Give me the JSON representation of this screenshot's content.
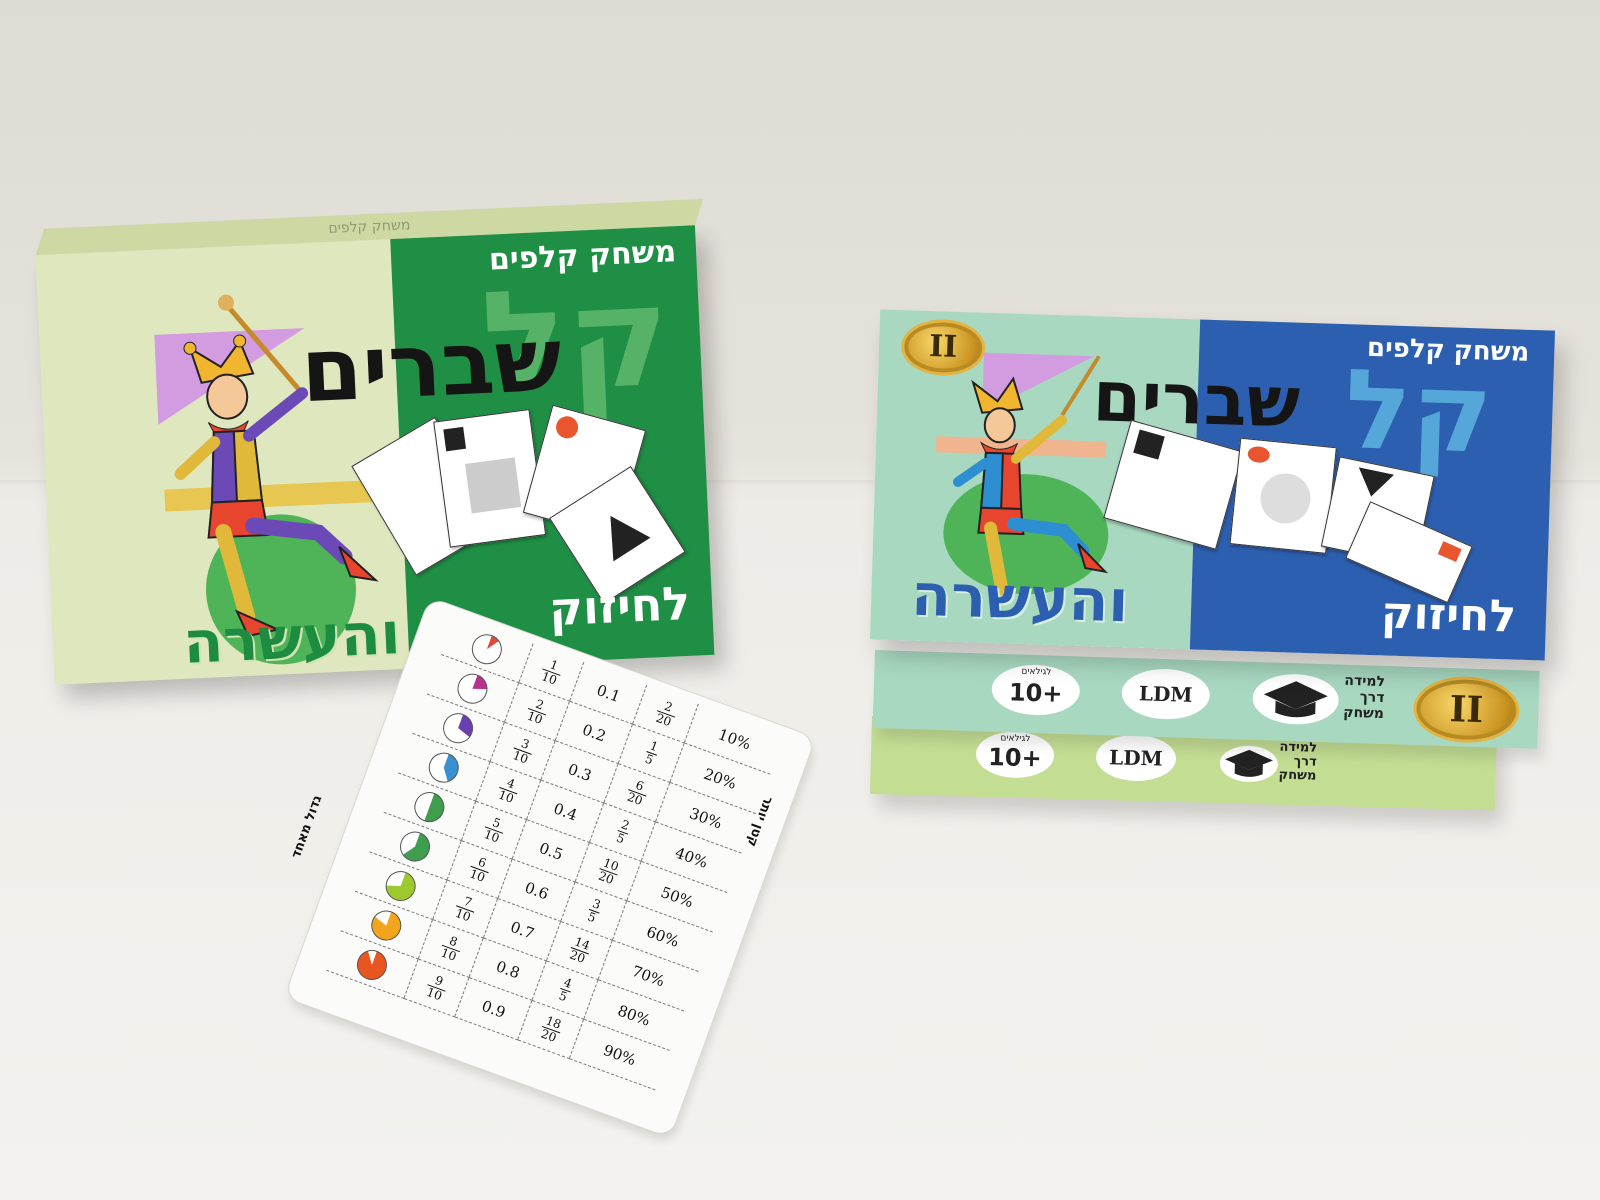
{
  "box1": {
    "subtitle": "משחק קלפים",
    "title_kal": "קל",
    "title_shvarim": "שברים",
    "label_lechizuk": "לחיזוק",
    "label_vehaashara": "והעשרה"
  },
  "box2": {
    "subtitle": "משחק קלפים",
    "title_kal": "קל",
    "title_shvarim": "שברים",
    "label_lechizuk": "לחיזוק",
    "label_vehaashara": "והעשרה",
    "edition": "II",
    "age_badge": "10+",
    "age_caption": "לגילאים",
    "brand": "LDM",
    "slogan": [
      "למידה",
      "דרך",
      "משחק"
    ]
  },
  "box2_bottom": {
    "age_badge": "10+",
    "age_caption": "לגילאים",
    "brand": "LDM",
    "slogan": [
      "למידה",
      "דרך",
      "משחק"
    ]
  },
  "ref_card": {
    "rows": [
      {
        "tenths": {
          "n": "1",
          "d": "10"
        },
        "decimal": "0.1",
        "equiv": {
          "n": "2",
          "d": "20"
        },
        "percent": "10%",
        "pie_color": "#e24b3b",
        "fraction": 0.1
      },
      {
        "tenths": {
          "n": "2",
          "d": "10"
        },
        "decimal": "0.2",
        "equiv": {
          "n": "1",
          "d": "5"
        },
        "percent": "20%",
        "pie_color": "#b5338f",
        "fraction": 0.2
      },
      {
        "tenths": {
          "n": "3",
          "d": "10"
        },
        "decimal": "0.3",
        "equiv": {
          "n": "6",
          "d": "20"
        },
        "percent": "30%",
        "pie_color": "#6a3fb0",
        "fraction": 0.3
      },
      {
        "tenths": {
          "n": "4",
          "d": "10"
        },
        "decimal": "0.4",
        "equiv": {
          "n": "2",
          "d": "5"
        },
        "percent": "40%",
        "pie_color": "#3a8fd1",
        "fraction": 0.4
      },
      {
        "tenths": {
          "n": "5",
          "d": "10"
        },
        "decimal": "0.5",
        "equiv": {
          "n": "10",
          "d": "20"
        },
        "percent": "50%",
        "pie_color": "#3e9e4d",
        "fraction": 0.5
      },
      {
        "tenths": {
          "n": "6",
          "d": "10"
        },
        "decimal": "0.6",
        "equiv": {
          "n": "3",
          "d": "5"
        },
        "percent": "60%",
        "pie_color": "#3e9e4d",
        "fraction": 0.6
      },
      {
        "tenths": {
          "n": "7",
          "d": "10"
        },
        "decimal": "0.7",
        "equiv": {
          "n": "14",
          "d": "20"
        },
        "percent": "70%",
        "pie_color": "#9bc92e",
        "fraction": 0.7
      },
      {
        "tenths": {
          "n": "8",
          "d": "10"
        },
        "decimal": "0.8",
        "equiv": {
          "n": "4",
          "d": "5"
        },
        "percent": "80%",
        "pie_color": "#f0a51c",
        "fraction": 0.8
      },
      {
        "tenths": {
          "n": "9",
          "d": "10"
        },
        "decimal": "0.9",
        "equiv": {
          "n": "18",
          "d": "20"
        },
        "percent": "90%",
        "pie_color": "#e8551f",
        "fraction": 0.9
      }
    ],
    "label_smaller": "קטן יותר",
    "label_bigger": "גדול מאחד"
  },
  "colors": {
    "box1_green": "#1f8f45",
    "box1_panel": "#dfe7bf",
    "box2_blue": "#2d5fb0",
    "box2_panel": "#a8d8c0",
    "box2_bottom": "#c3dd93"
  }
}
